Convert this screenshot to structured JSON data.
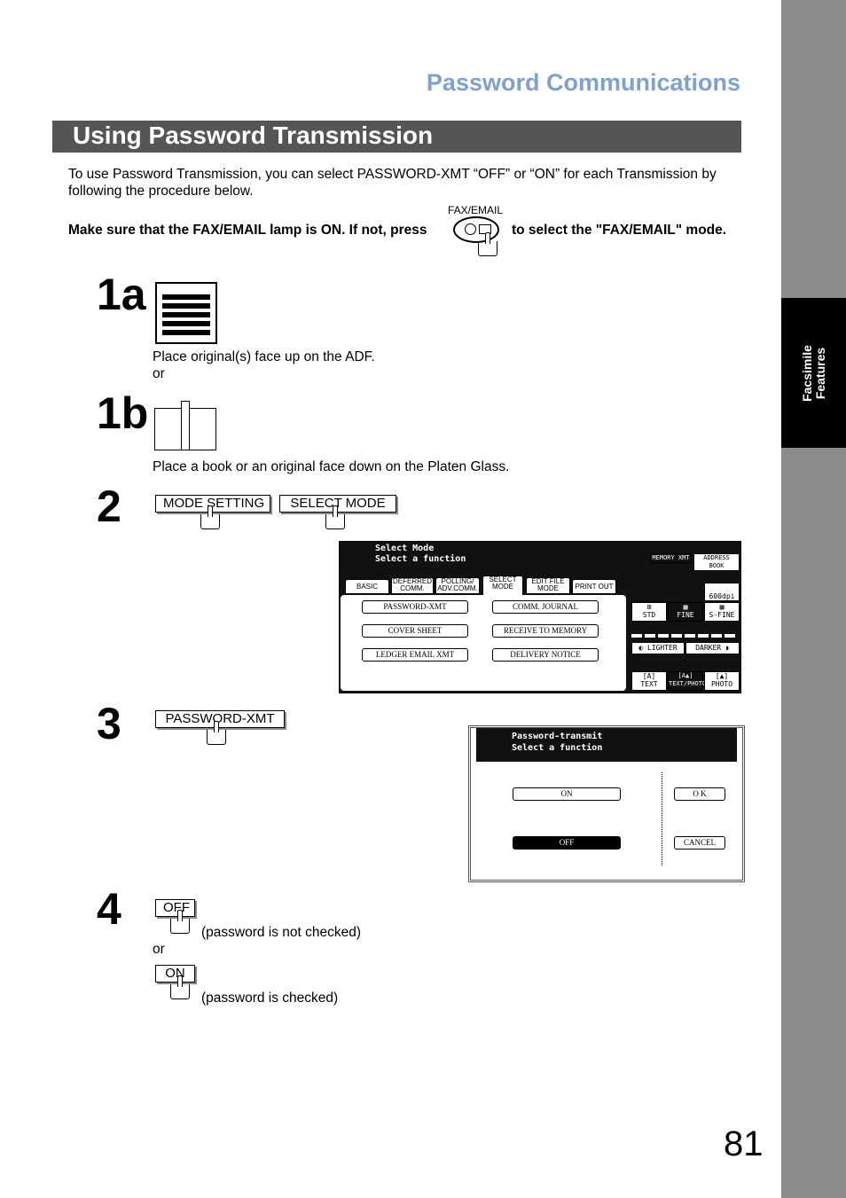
{
  "header": {
    "section_title": "Password Communications",
    "banner_title": "Using Password Transmission"
  },
  "sidebar": {
    "tab_line1": "Facsimile",
    "tab_line2": "Features"
  },
  "intro": {
    "text": "To use Password Transmission, you can select PASSWORD-XMT “OFF” or “ON” for each Transmission by following the procedure below.",
    "lamp_text_before": "Make sure that the FAX/EMAIL lamp is ON.  If not, press",
    "lamp_text_after": "to select the \"FAX/EMAIL\" mode.",
    "button_label": "FAX/EMAIL"
  },
  "steps": {
    "s1a": {
      "num": "1a",
      "text": "Place original(s) face up on the ADF.",
      "or": "or"
    },
    "s1b": {
      "num": "1b",
      "text": "Place a book or an original face down on the Platen Glass."
    },
    "s2": {
      "num": "2",
      "keys": [
        "MODE SETTING",
        "SELECT MODE"
      ]
    },
    "s3": {
      "num": "3",
      "key": "PASSWORD-XMT"
    },
    "s4": {
      "num": "4",
      "off_key": "OFF",
      "off_text": "(password is not checked)",
      "or": "or",
      "on_key": "ON",
      "on_text": "(password is checked)"
    }
  },
  "lcd1": {
    "line1": "Select Mode",
    "line2": "Select a function",
    "tabs": [
      "BASIC MENU",
      "DEFERRED COMM.",
      "POLLING/ ADV.COMM.",
      "SELECT MODE",
      "EDIT FILE MODE",
      "PRINT OUT"
    ],
    "active_tab": "SELECT MODE",
    "buttons": [
      "PASSWORD-XMT",
      "COMM. JOURNAL",
      "COVER SHEET",
      "RECEIVE TO MEMORY",
      "LEDGER EMAIL XMT",
      "DELIVERY NOTICE"
    ],
    "memory_xmt": "MEMORY XMT",
    "address_book": "ADDRESS BOOK",
    "res_600": "600dpi",
    "resolutions": [
      "STD",
      "FINE",
      "S-FINE"
    ],
    "selected_resolution": "FINE",
    "lighter": "LIGHTER",
    "darker": "DARKER",
    "modes": [
      "TEXT",
      "TEXT/PHOTO",
      "PHOTO"
    ],
    "selected_mode": "TEXT/PHOTO"
  },
  "lcd2": {
    "line1": "Password-transmit",
    "line2": "Select a function",
    "on": "ON",
    "off": "OFF",
    "selected": "OFF",
    "ok": "O K",
    "cancel": "CANCEL"
  },
  "page_number": "81"
}
